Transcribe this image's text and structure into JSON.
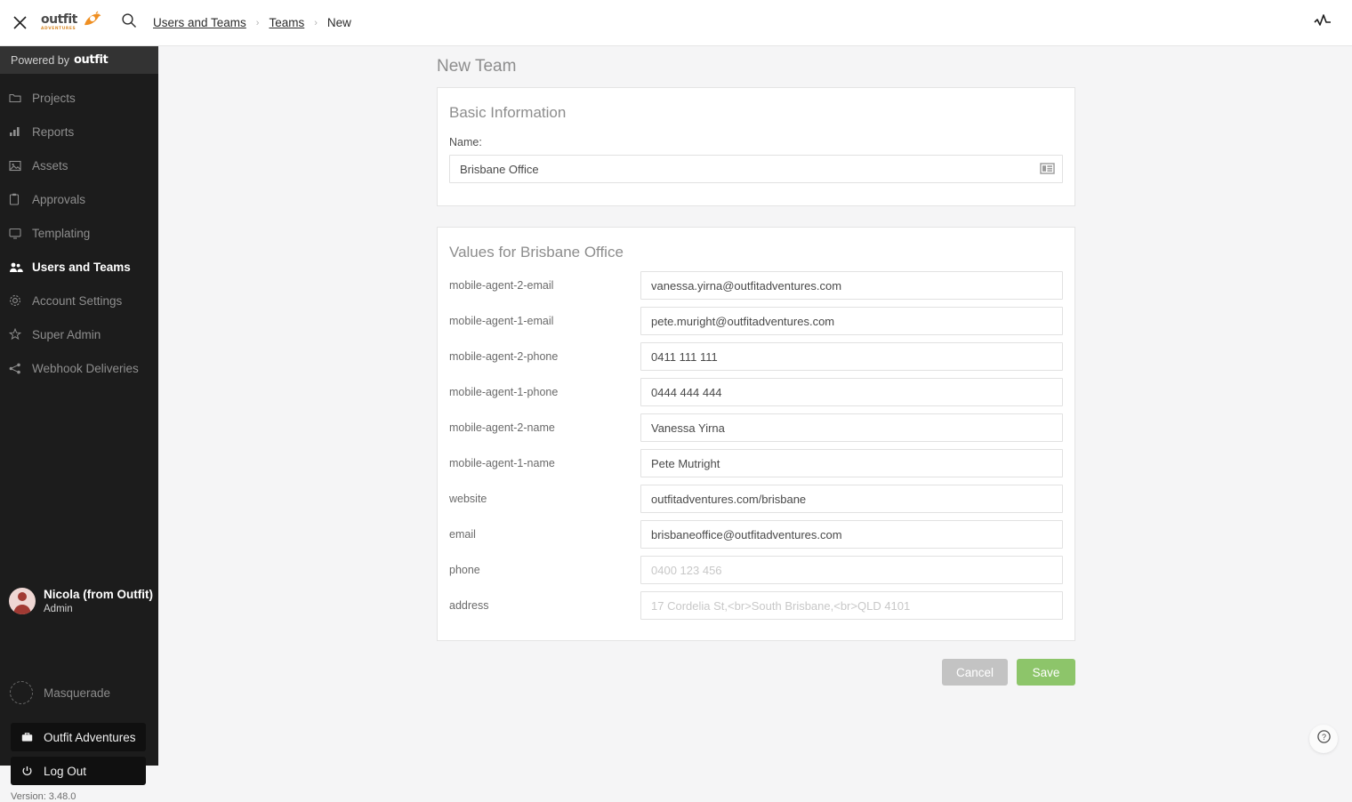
{
  "topbar": {
    "close_icon": "close-icon",
    "logo_word": "outfit",
    "logo_sub": "ADVENTURES",
    "search_icon": "search-icon",
    "breadcrumbs": [
      {
        "label": "Users and Teams",
        "link": true
      },
      {
        "label": "Teams",
        "link": true
      },
      {
        "label": "New",
        "link": false
      }
    ],
    "separator": "›",
    "activity_icon": "activity-pulse-icon"
  },
  "sidebar": {
    "powered_by_prefix": "Powered by",
    "powered_by_brand": "outfit",
    "items": [
      {
        "label": "Projects",
        "icon": "folder-icon",
        "active": false
      },
      {
        "label": "Reports",
        "icon": "bar-chart-icon",
        "active": false
      },
      {
        "label": "Assets",
        "icon": "image-icon",
        "active": false
      },
      {
        "label": "Approvals",
        "icon": "clipboard-icon",
        "active": false
      },
      {
        "label": "Templating",
        "icon": "monitor-icon",
        "active": false
      },
      {
        "label": "Users and Teams",
        "icon": "users-icon",
        "active": true
      },
      {
        "label": "Account Settings",
        "icon": "gear-icon",
        "active": false
      },
      {
        "label": "Super Admin",
        "icon": "star-icon",
        "active": false
      },
      {
        "label": "Webhook Deliveries",
        "icon": "share-network-icon",
        "active": false
      }
    ],
    "user": {
      "name": "Nicola (from Outfit)",
      "role": "Admin",
      "avatar_icon": "user-avatar"
    },
    "masquerade": {
      "label": "Masquerade",
      "icon": "dashed-circle-icon"
    },
    "org_button": {
      "label": "Outfit Adventures",
      "icon": "briefcase-icon"
    },
    "logout_button": {
      "label": "Log Out",
      "icon": "power-icon"
    },
    "version": "Version: 3.48.0"
  },
  "main": {
    "page_title": "New Team",
    "basic_information": {
      "title": "Basic Information",
      "name_label": "Name:",
      "name_value": "Brisbane Office",
      "name_placeholder": "",
      "name_icon": "layout-grid-icon"
    },
    "values_section": {
      "title": "Values for Brisbane Office",
      "fields": [
        {
          "label": "mobile-agent-2-email",
          "value": "vanessa.yirna@outfitadventures.com",
          "placeholder": "",
          "is_placeholder": false
        },
        {
          "label": "mobile-agent-1-email",
          "value": "pete.muright@outfitadventures.com",
          "placeholder": "",
          "is_placeholder": false
        },
        {
          "label": "mobile-agent-2-phone",
          "value": "0411 111 111",
          "placeholder": "",
          "is_placeholder": false
        },
        {
          "label": "mobile-agent-1-phone",
          "value": "0444 444 444",
          "placeholder": "",
          "is_placeholder": false
        },
        {
          "label": "mobile-agent-2-name",
          "value": "Vanessa Yirna",
          "placeholder": "",
          "is_placeholder": false
        },
        {
          "label": "mobile-agent-1-name",
          "value": "Pete Mutright",
          "placeholder": "",
          "is_placeholder": false
        },
        {
          "label": "website",
          "value": "outfitadventures.com/brisbane",
          "placeholder": "",
          "is_placeholder": false
        },
        {
          "label": "email",
          "value": "brisbaneoffice@outfitadventures.com",
          "placeholder": "",
          "is_placeholder": false
        },
        {
          "label": "phone",
          "value": "",
          "placeholder": "0400 123 456",
          "is_placeholder": true
        },
        {
          "label": "address",
          "value": "",
          "placeholder": "17 Cordelia St,<br>South Brisbane,<br>QLD 4101",
          "is_placeholder": true
        }
      ]
    },
    "cancel_label": "Cancel",
    "save_label": "Save",
    "help_icon": "question-mark-icon"
  },
  "colors": {
    "sidebar_bg": "#1c1c1c",
    "powered_bg": "#333333",
    "main_bg": "#f5f5f6",
    "accent_orange": "#ef8f22",
    "save_green": "#8dc56a",
    "cancel_gray": "#c3c3c3",
    "avatar_red": "#a13a33"
  }
}
